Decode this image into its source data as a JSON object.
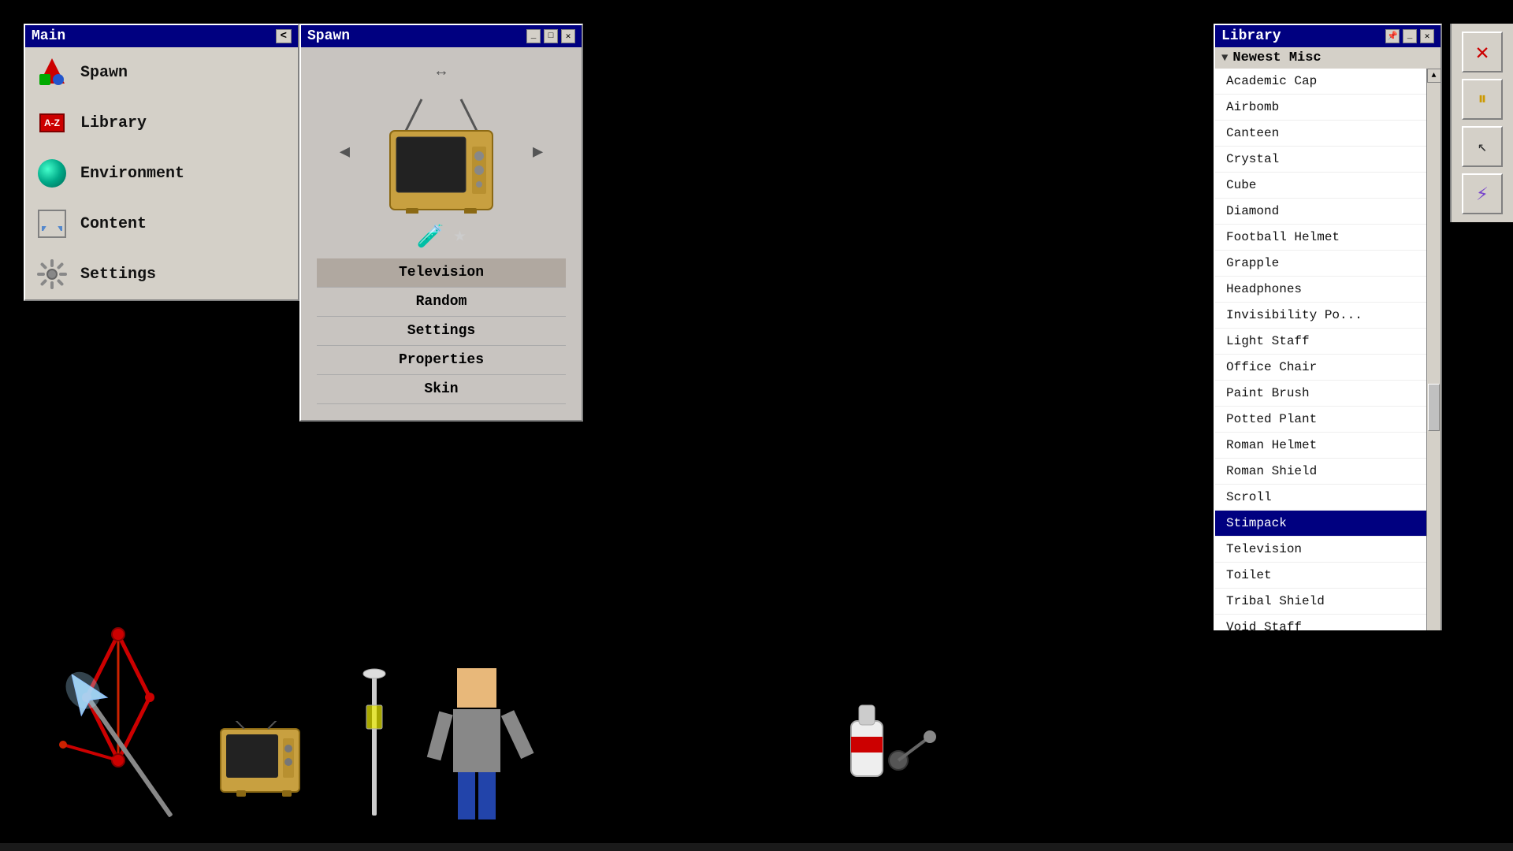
{
  "scene": {
    "background": "#000000"
  },
  "main_panel": {
    "title": "Main",
    "collapse_btn": "<",
    "items": [
      {
        "id": "spawn",
        "label": "Spawn",
        "icon": "spawn-icon"
      },
      {
        "id": "library",
        "label": "Library",
        "icon": "library-icon"
      },
      {
        "id": "environment",
        "label": "Environment",
        "icon": "environment-icon"
      },
      {
        "id": "content",
        "label": "Content",
        "icon": "content-icon"
      },
      {
        "id": "settings",
        "label": "Settings",
        "icon": "settings-icon"
      }
    ]
  },
  "spawn_panel": {
    "title": "Spawn",
    "item_name": "Television",
    "menu_items": [
      {
        "id": "television",
        "label": "Television",
        "selected": true
      },
      {
        "id": "random",
        "label": "Random",
        "selected": false
      },
      {
        "id": "settings",
        "label": "Settings",
        "selected": false
      },
      {
        "id": "properties",
        "label": "Properties",
        "selected": false
      },
      {
        "id": "skin",
        "label": "Skin",
        "selected": false
      }
    ]
  },
  "library_panel": {
    "title": "Library",
    "category": "Newest Misc",
    "items": [
      {
        "id": "academic-cap",
        "label": "Academic Cap",
        "selected": false
      },
      {
        "id": "airbomb",
        "label": "Airbomb",
        "selected": false
      },
      {
        "id": "canteen",
        "label": "Canteen",
        "selected": false
      },
      {
        "id": "crystal",
        "label": "Crystal",
        "selected": false
      },
      {
        "id": "cube",
        "label": "Cube",
        "selected": false
      },
      {
        "id": "diamond",
        "label": "Diamond",
        "selected": false
      },
      {
        "id": "football-helmet",
        "label": "Football Helmet",
        "selected": false
      },
      {
        "id": "grapple",
        "label": "Grapple",
        "selected": false
      },
      {
        "id": "headphones",
        "label": "Headphones",
        "selected": false
      },
      {
        "id": "invisibility-potion",
        "label": "Invisibility Po...",
        "selected": false
      },
      {
        "id": "light-staff",
        "label": "Light Staff",
        "selected": false
      },
      {
        "id": "office-chair",
        "label": "Office Chair",
        "selected": false
      },
      {
        "id": "paint-brush",
        "label": "Paint Brush",
        "selected": false
      },
      {
        "id": "potted-plant",
        "label": "Potted Plant",
        "selected": false
      },
      {
        "id": "roman-helmet",
        "label": "Roman Helmet",
        "selected": false
      },
      {
        "id": "roman-shield",
        "label": "Roman Shield",
        "selected": false
      },
      {
        "id": "scroll",
        "label": "Scroll",
        "selected": false
      },
      {
        "id": "stimpack",
        "label": "Stimpack",
        "selected": true
      },
      {
        "id": "television",
        "label": "Television",
        "selected": false
      },
      {
        "id": "toilet",
        "label": "Toilet",
        "selected": false
      },
      {
        "id": "tribal-shield",
        "label": "Tribal Shield",
        "selected": false
      },
      {
        "id": "void-staff",
        "label": "Void Staff",
        "selected": false
      }
    ]
  },
  "right_toolbar": {
    "buttons": [
      {
        "id": "close",
        "label": "✕",
        "icon": "x-icon"
      },
      {
        "id": "pause",
        "label": "⏸",
        "icon": "pause-icon"
      },
      {
        "id": "cursor",
        "label": "↖",
        "icon": "cursor-icon"
      },
      {
        "id": "lightning",
        "label": "⚡",
        "icon": "lightning-icon"
      }
    ]
  }
}
